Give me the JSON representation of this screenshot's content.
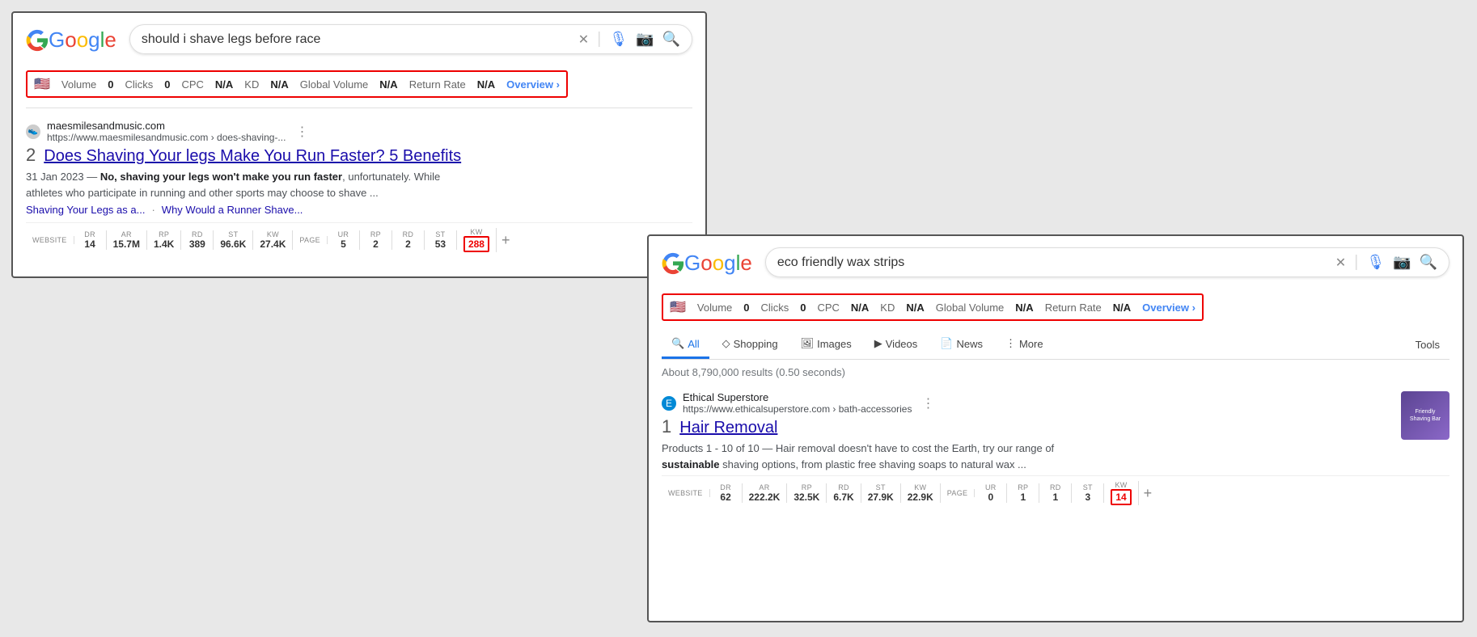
{
  "window1": {
    "query": "should i shave legs before race",
    "seo": {
      "flag": "🇺🇸",
      "volume_label": "Volume",
      "volume_value": "0",
      "clicks_label": "Clicks",
      "clicks_value": "0",
      "cpc_label": "CPC",
      "cpc_value": "N/A",
      "kd_label": "KD",
      "kd_value": "N/A",
      "global_volume_label": "Global Volume",
      "global_volume_value": "N/A",
      "return_rate_label": "Return Rate",
      "return_rate_value": "N/A",
      "overview_label": "Overview ›"
    },
    "result": {
      "rank": "2",
      "favicon": "👟",
      "source": "maesmilesandmusic.com",
      "url": "https://www.maesmilesandmusic.com › does-shaving-...",
      "title": "Does Shaving Your legs Make You Run Faster? 5 Benefits",
      "date": "31 Jan 2023",
      "snippet1": "— No, shaving your legs won't make you run faster, unfortunately. While",
      "snippet2": "athletes who participate in running and other sports may choose to shave ...",
      "link1": "Shaving Your Legs as a...",
      "link2": "Why Would a Runner Shave...",
      "metrics": [
        {
          "label": "WEBSITE",
          "value": ""
        },
        {
          "label": "DR",
          "value": "14"
        },
        {
          "label": "AR",
          "value": "15.7M"
        },
        {
          "label": "RP",
          "value": "1.4K"
        },
        {
          "label": "RD",
          "value": "389"
        },
        {
          "label": "ST",
          "value": "96.6K"
        },
        {
          "label": "KW",
          "value": "27.4K"
        },
        {
          "label": "PAGE",
          "value": ""
        },
        {
          "label": "UR",
          "value": "5"
        },
        {
          "label": "RP",
          "value": "2"
        },
        {
          "label": "RD",
          "value": "2"
        },
        {
          "label": "ST",
          "value": "53"
        },
        {
          "label": "KW",
          "value": "288",
          "highlighted": true
        }
      ]
    }
  },
  "window2": {
    "query": "eco friendly wax strips",
    "seo": {
      "flag": "🇺🇸",
      "volume_label": "Volume",
      "volume_value": "0",
      "clicks_label": "Clicks",
      "clicks_value": "0",
      "cpc_label": "CPC",
      "cpc_value": "N/A",
      "kd_label": "KD",
      "kd_value": "N/A",
      "global_volume_label": "Global Volume",
      "global_volume_value": "N/A",
      "return_rate_label": "Return Rate",
      "return_rate_value": "N/A",
      "overview_label": "Overview ›"
    },
    "tabs": [
      {
        "label": "All",
        "icon": "🔍",
        "active": true
      },
      {
        "label": "Shopping",
        "icon": "◇"
      },
      {
        "label": "Images",
        "icon": "🖼"
      },
      {
        "label": "Videos",
        "icon": "▶"
      },
      {
        "label": "News",
        "icon": "📄"
      },
      {
        "label": "More",
        "icon": "⋮"
      }
    ],
    "tools_label": "Tools",
    "results_count": "About 8,790,000 results (0.50 seconds)",
    "result": {
      "rank": "1",
      "favicon_color": "#0089d6",
      "source": "Ethical Superstore",
      "url": "https://www.ethicalsuperstore.com › bath-accessories",
      "title": "Hair Removal",
      "snippet1": "Products 1 - 10 of 10 — Hair removal doesn't have to cost the Earth, try our range of",
      "snippet2": "sustainable shaving options, from plastic free shaving soaps to natural wax ...",
      "snippet_bold1": "sustainable",
      "metrics": [
        {
          "label": "WEBSITE",
          "value": ""
        },
        {
          "label": "DR",
          "value": "62"
        },
        {
          "label": "AR",
          "value": "222.2K"
        },
        {
          "label": "RP",
          "value": "32.5K"
        },
        {
          "label": "RD",
          "value": "6.7K"
        },
        {
          "label": "ST",
          "value": "27.9K"
        },
        {
          "label": "KW",
          "value": "22.9K"
        },
        {
          "label": "PAGE",
          "value": ""
        },
        {
          "label": "UR",
          "value": "0"
        },
        {
          "label": "RP",
          "value": "1"
        },
        {
          "label": "RD",
          "value": "1"
        },
        {
          "label": "ST",
          "value": "3"
        },
        {
          "label": "KW",
          "value": "14",
          "highlighted": true
        }
      ]
    }
  }
}
